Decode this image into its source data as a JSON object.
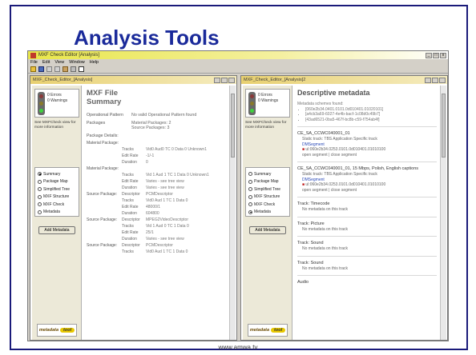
{
  "slide": {
    "title": "Analysis Tools",
    "footer": "www.amwa.tv"
  },
  "app": {
    "title": "MXF Check Editor [Analysis]",
    "menus": [
      "File",
      "Edit",
      "View",
      "Window",
      "Help"
    ],
    "window_controls": [
      "_",
      "□",
      "x"
    ]
  },
  "left_window": {
    "title": "MXF_Check_Editor_[Analysis]",
    "status": {
      "errors": "0 Errors",
      "warnings": "0 Warnings"
    },
    "see_text": "See MXFCheck view for more information",
    "radio_options": [
      {
        "label": "Summary",
        "selected": true
      },
      {
        "label": "Package Map",
        "selected": false
      },
      {
        "label": "Simplified Tree",
        "selected": false
      },
      {
        "label": "MXF Structure",
        "selected": false
      },
      {
        "label": "MXF Check",
        "selected": false
      },
      {
        "label": "Metadata",
        "selected": false
      }
    ],
    "add_button": "Add Metadata",
    "logo": {
      "text": "metadata",
      "pill": "tool"
    },
    "heading_line1": "MXF File",
    "heading_line2": "Summary",
    "op_label": "Operational Pattern",
    "op_value": "No valid Operational Pattern found",
    "packages_label": "Packages",
    "packages_material": "Material Packages: 2",
    "packages_source": "Source Packages: 3",
    "details_label": "Package Details:",
    "mp1_label": "Material Package:",
    "mp1_tracks": "Vid0 Aud0 TC 0 Data 0 Unknown1",
    "mp1_editrate": "-1/-1",
    "mp1_duration": "0",
    "mp2_label": "Material Package:",
    "mp2_tracks": "Vid 1 Aud 1 TC 1 Data 0 Unknown1",
    "mp2_editrate": "Varies - see tree view",
    "mp2_duration": "Varies - see tree view",
    "sp1_label": "Source Package:",
    "sp1_descriptor": "PCMDescriptor",
    "sp1_tracks": "Vid0 Aud 1 TC 1 Data 0",
    "sp1_editrate": "48000/1",
    "sp1_duration": "604800",
    "sp2_label": "Source Package:",
    "sp2_descriptor": "MPEG2VideoDescriptor",
    "sp2_tracks": "Vid 1 Aud 0 TC 1 Data 0",
    "sp2_editrate": "25/1",
    "sp2_duration": "Varies - see tree view",
    "sp3_label": "Source Package:",
    "sp3_descriptor": "PCMDescriptor",
    "sp3_tracks": "Vid0 Aud 1 TC 1 Data 0",
    "labels": {
      "tracks": "Tracks",
      "editrate": "Edit Rate",
      "duration": "Duration",
      "descriptor": "Descriptor"
    }
  },
  "right_window": {
    "title": "MXF_Check_Editor_[Analysis]2",
    "status": {
      "errors": "0 Errors",
      "warnings": "0 Warnings"
    },
    "see_text": "See MXFCheck view for more information",
    "radio_options": [
      {
        "label": "Summary",
        "selected": false
      },
      {
        "label": "Package Map",
        "selected": false
      },
      {
        "label": "Simplified Tree",
        "selected": false
      },
      {
        "label": "MXF Structure",
        "selected": false
      },
      {
        "label": "MXF Check",
        "selected": false
      },
      {
        "label": "Metadata",
        "selected": true
      }
    ],
    "add_button": "Add Metadata",
    "logo": {
      "text": "metadata",
      "pill": "tool"
    },
    "heading": "Descriptive metadata",
    "schemes_label": "Metadata schemes found:",
    "schemes": [
      "[060e2b34.0401.0101.0d010401.01020101]",
      "[a4cb3a69-6027-4e4b-bacf-1c08d0c49b7]",
      "[43ad6521-0ba5-467f-bc8b-c59-f754ab4f]"
    ],
    "t1_head": "CE_SA_CCWC040001_01",
    "t1_static": "Static track: TBS Application Specific track",
    "t1_seg": "DMSegment",
    "t1_ul": "ul:060e2b34.0253.0101.0d010401.01010100",
    "t1_open": "open segment | close segment",
    "t2_head": "CE_SA_CCWC040001_01, 15 Mbps, Polish, English captions",
    "t2_static": "Static track: TBS Application Specific track",
    "t2_seg": "DMSegment",
    "t2_ul": "ul:060e2b34.0253.0101.0d010401.01010100",
    "t2_open": "open segment | close segment",
    "tracks": [
      {
        "head": "Track: Timecode",
        "note": "No metadata on this track"
      },
      {
        "head": "Track: Picture",
        "note": "No metadata on this track"
      },
      {
        "head": "Track: Sound",
        "note": "No metadata on this track"
      },
      {
        "head": "Track: Sound",
        "note": "No metadata on this track"
      }
    ],
    "audio": "Audio"
  }
}
